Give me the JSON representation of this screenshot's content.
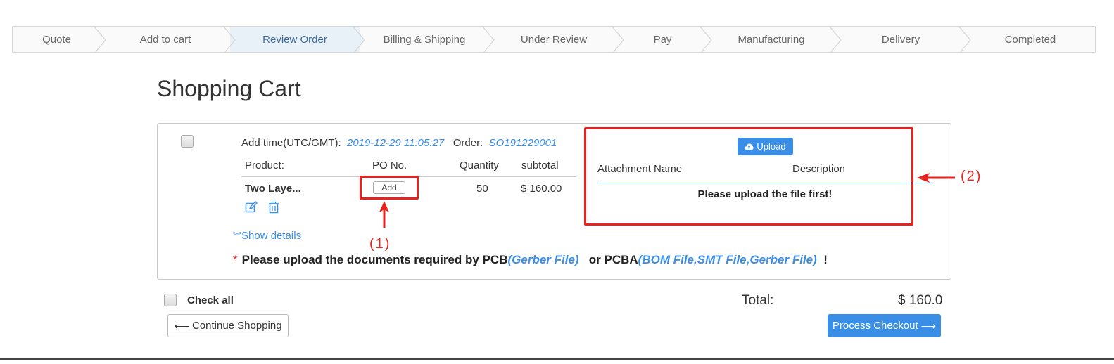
{
  "steps": [
    {
      "label": "Quote",
      "active": false
    },
    {
      "label": "Add to cart",
      "active": false
    },
    {
      "label": "Review Order",
      "active": true
    },
    {
      "label": "Billing & Shipping",
      "active": false
    },
    {
      "label": "Under Review",
      "active": false
    },
    {
      "label": "Pay",
      "active": false
    },
    {
      "label": "Manufacturing",
      "active": false
    },
    {
      "label": "Delivery",
      "active": false
    },
    {
      "label": "Completed",
      "active": false
    }
  ],
  "page": {
    "title": "Shopping Cart"
  },
  "cart_item": {
    "add_time_label": "Add time(UTC/GMT):",
    "add_time_value": "2019-12-29 11:05:27",
    "order_label": "Order:",
    "order_value": "SO191229001",
    "columns": {
      "product": "Product:",
      "po_no": "PO No.",
      "quantity": "Quantity",
      "subtotal": "subtotal"
    },
    "product_name": "Two Laye...",
    "po_add_label": "Add",
    "quantity": "50",
    "subtotal": "$ 160.00",
    "show_details": "Show details",
    "notice": {
      "star": "*",
      "text1": "Please upload the documents required by PCB",
      "pcb_files": "(Gerber File)",
      "text2": "or PCBA",
      "pcba_files": "(BOM File,SMT File,Gerber File)",
      "text3": "!"
    }
  },
  "attachments": {
    "upload_label": "Upload",
    "columns": {
      "name": "Attachment Name",
      "description": "Description"
    },
    "empty_message": "Please upload the file first!"
  },
  "annotations": {
    "one": "(1)",
    "two": "(2)"
  },
  "footer": {
    "check_all": "Check all",
    "total_label": "Total:",
    "total_value": "$ 160.0",
    "continue_label": "Continue Shopping",
    "checkout_label": "Process Checkout"
  },
  "colors": {
    "accent": "#3a8ee6",
    "annotation": "#e8231d",
    "active_step_bg": "#e8f0f8"
  }
}
